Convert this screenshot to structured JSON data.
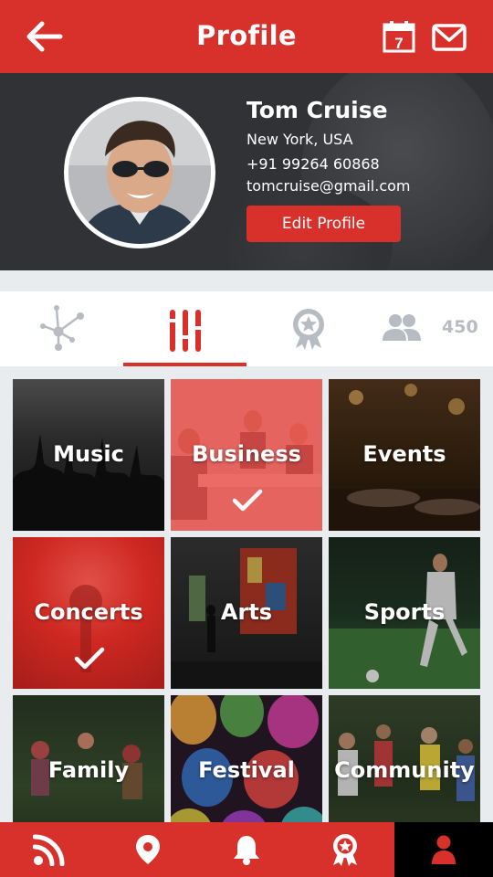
{
  "app_bar": {
    "title": "Profile",
    "icons": [
      "back-arrow-icon",
      "calendar-icon",
      "mail-icon"
    ],
    "calendar_day": "7"
  },
  "profile": {
    "name": "Tom Cruise",
    "location": "New York, USA",
    "phone": "+91 99264 60868",
    "email": "tomcruise@gmail.com",
    "edit_label": "Edit Profile"
  },
  "tabs": {
    "items": [
      {
        "icon": "network-icon",
        "active": false
      },
      {
        "icon": "equalizer-icon",
        "active": true
      },
      {
        "icon": "badge-icon",
        "active": false
      },
      {
        "icon": "people-icon",
        "active": false
      }
    ],
    "people_count": "450"
  },
  "interests": [
    {
      "label": "Music",
      "selected": false
    },
    {
      "label": "Business",
      "selected": true
    },
    {
      "label": "Events",
      "selected": false
    },
    {
      "label": "Concerts",
      "selected": true
    },
    {
      "label": "Arts",
      "selected": false
    },
    {
      "label": "Sports",
      "selected": false
    },
    {
      "label": "Family",
      "selected": false
    },
    {
      "label": "Festival",
      "selected": false
    },
    {
      "label": "Community",
      "selected": false
    }
  ],
  "bottom_nav": {
    "items": [
      "rss-icon",
      "location-pin-icon",
      "bell-icon",
      "award-icon",
      "user-icon"
    ],
    "active": "user-icon"
  },
  "colors": {
    "primary": "#d8302b",
    "hero_bg": "#303236",
    "tab_icon": "#b6bcc2"
  }
}
